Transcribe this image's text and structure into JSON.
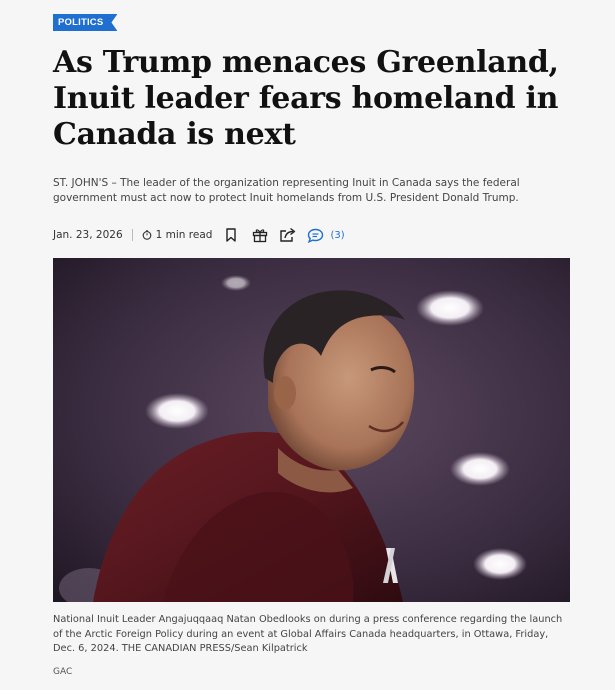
{
  "section": {
    "label": "POLITICS"
  },
  "article": {
    "headline": "As Trump menaces Greenland, Inuit leader fears homeland in Canada is next",
    "dek": "ST. JOHN'S – The leader of the organization representing Inuit in Canada says the federal government must act now to protect Inuit homelands from U.S. President Donald Trump.",
    "date": "Jan. 23, 2026",
    "read_time": "1 min read",
    "comment_count": "(3)"
  },
  "icons": {
    "clock": "clock-icon",
    "bookmark": "bookmark-icon",
    "gift": "gift-icon",
    "share": "share-icon",
    "comments": "comment-bubble-icon"
  },
  "photo": {
    "caption": "National Inuit Leader Angajuqqaaq Natan Obedlooks on during a press conference regarding the launch of the Arctic Foreign Policy during an event at Global Affairs Canada headquarters, in Ottawa, Friday, Dec. 6, 2024. THE CANADIAN PRESS/Sean Kilpatrick",
    "credit": "GAC"
  },
  "colors": {
    "accent": "#1e6fd0",
    "background": "#f6f6f6",
    "headline": "#111111"
  }
}
